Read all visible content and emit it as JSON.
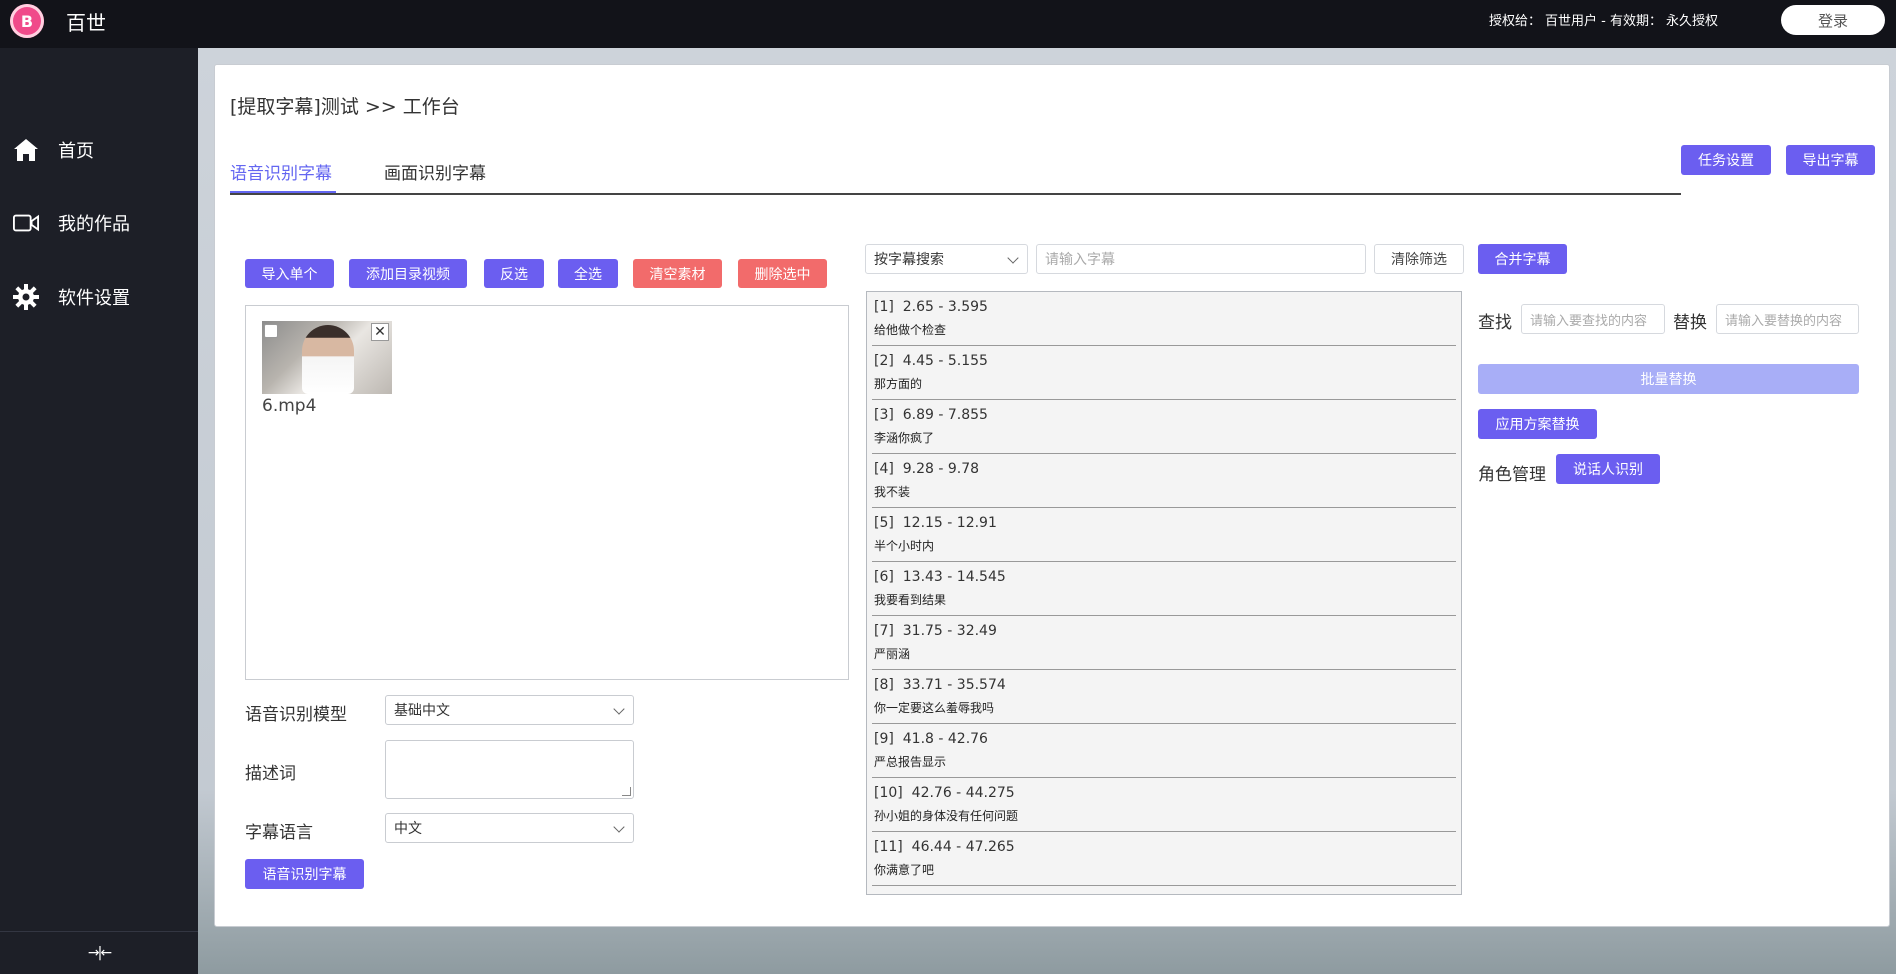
{
  "app": {
    "title": "百世",
    "logo_letter": "B"
  },
  "header": {
    "license_label": "授权给：",
    "license_user": "百世用户 - 有效期：",
    "license_term": "永久授权",
    "login_label": "登录"
  },
  "sidebar": {
    "items": [
      {
        "label": "首页",
        "icon": "home-icon"
      },
      {
        "label": "我的作品",
        "icon": "video-camera-icon"
      },
      {
        "label": "软件设置",
        "icon": "gear-icon"
      }
    ],
    "collapse_glyph": "→|←"
  },
  "page": {
    "title": "[提取字幕]测试 >> 工作台",
    "tabs": [
      {
        "label": "语音识别字幕",
        "active": true
      },
      {
        "label": "画面识别字幕",
        "active": false
      }
    ],
    "task_settings_label": "任务设置",
    "export_label": "导出字幕"
  },
  "toolbar": {
    "import_single": "导入单个",
    "add_folder_video": "添加目录视频",
    "invert_select": "反选",
    "select_all": "全选",
    "clear_material": "清空素材",
    "delete_selected": "删除选中"
  },
  "material": {
    "file_name": "6.mp4"
  },
  "form": {
    "model_label": "语音识别模型",
    "model_value": "基础中文",
    "prompt_label": "描述词",
    "language_label": "字幕语言",
    "language_value": "中文",
    "recognize_button": "语音识别字幕"
  },
  "search": {
    "mode_value": "按字幕搜索",
    "placeholder": "请输入字幕",
    "clear_filter": "清除筛选"
  },
  "subtitles": [
    {
      "index": "[1]",
      "range": "2.65 - 3.595",
      "text": "给他做个检查"
    },
    {
      "index": "[2]",
      "range": "4.45 - 5.155",
      "text": "那方面的"
    },
    {
      "index": "[3]",
      "range": "6.89 - 7.855",
      "text": "李涵你疯了"
    },
    {
      "index": "[4]",
      "range": "9.28 - 9.78",
      "text": "我不装"
    },
    {
      "index": "[5]",
      "range": "12.15 - 12.91",
      "text": "半个小时内"
    },
    {
      "index": "[6]",
      "range": "13.43 - 14.545",
      "text": "我要看到结果"
    },
    {
      "index": "[7]",
      "range": "31.75 - 32.49",
      "text": "严丽涵"
    },
    {
      "index": "[8]",
      "range": "33.71 - 35.574",
      "text": "你一定要这么羞辱我吗"
    },
    {
      "index": "[9]",
      "range": "41.8 - 42.76",
      "text": "严总报告显示"
    },
    {
      "index": "[10]",
      "range": "42.76 - 44.275",
      "text": "孙小姐的身体没有任何问题"
    },
    {
      "index": "[11]",
      "range": "46.44 - 47.265",
      "text": "你满意了吧"
    }
  ],
  "right_panel": {
    "merge_label": "合并字幕",
    "find_label": "查找",
    "find_placeholder": "请输入要查找的内容",
    "replace_label": "替换",
    "replace_placeholder": "请输入要替换的内容",
    "batch_replace": "批量替换",
    "apply_scheme": "应用方案替换",
    "role_label": "角色管理",
    "speaker_recognition": "说话人识别"
  },
  "colors": {
    "accent": "#6b5ef0",
    "danger": "#f26b6b",
    "active_tab": "#6366f1",
    "sidebar_bg": "#1d1f27",
    "topbar_bg": "#121319"
  }
}
